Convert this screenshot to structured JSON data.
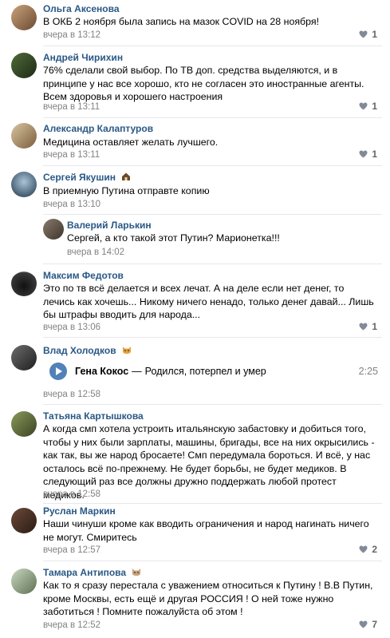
{
  "comments": [
    {
      "name": "Ольга Аксенова",
      "text": "В ОКБ 2 ноября была запись на мазок COVID на 28 ноября!",
      "date": "вчера в 13:12",
      "likes": "1"
    },
    {
      "name": "Андрей Чирихин",
      "text": "76% сделали свой выбор. По ТВ доп. средства выделяются, и в принципе у нас все хорошо, кто не согласен это иностранные агенты. Всем здоровья и хорошего настроения",
      "date": "вчера в 13:11",
      "likes": "1"
    },
    {
      "name": "Александр Калаптуров",
      "text": "Медицина оставляет желать лучшего.",
      "date": "вчера в 13:11",
      "likes": "1"
    },
    {
      "name": "Сергей Якушин",
      "text": "В приемную Путина отправте копию",
      "date": "вчера в 13:10",
      "likes": ""
    },
    {
      "name": "Валерий Ларькин",
      "text": "Сергей, а кто такой этот Путин? Марионетка!!!",
      "date": "вчера в 14:02",
      "likes": ""
    },
    {
      "name": "Максим Федотов",
      "text": "Это по тв всё делается и всех лечат. А на деле если нет денег, то лечись как хочешь... Никому ничего ненадо, только денег давай... Лишь бы штрафы вводить для народа...",
      "date": "вчера в 13:06",
      "likes": "1"
    },
    {
      "name": "Влад Холодков",
      "text": "",
      "date": "вчера в 12:58",
      "likes": ""
    },
    {
      "name": "Татьяна Картышкова",
      "text": "А когда смп хотела устроить итальянскую забастовку и добиться того, чтобы у них были зарплаты, машины, бригады, все на них окрысились - как так, вы же народ бросаете! Смп передумала бороться. И всё, у нас осталось всё по-прежнему. Не будет борьбы, не будет медиков. В следующий раз все должны дружно поддержать любой протест медиков.",
      "date": "вчера в 12:58",
      "likes": ""
    },
    {
      "name": "Руслан Маркин",
      "text": "Наши чинуши кроме как вводить ограничения и народ нагинать ничего не могут. Смиритесь",
      "date": "вчера в 12:57",
      "likes": "2"
    },
    {
      "name": "Тамара Антипова",
      "text": "Как то я сразу перестала с уважением относиться к Путину ! В.В Путин, кроме Москвы, есть ещё и другая РОССИЯ ! О ней тоже нужно заботиться ! Помните пожалуйста об этом !",
      "date": "вчера в 12:52",
      "likes": "7"
    }
  ],
  "audio": {
    "artist": "Гена Кокос",
    "dash": "—",
    "track": "Родился, потерпел и умер",
    "duration": "2:25"
  },
  "colors": {
    "link": "#2a5885",
    "meta": "#828282",
    "accent": "#5181b8"
  }
}
